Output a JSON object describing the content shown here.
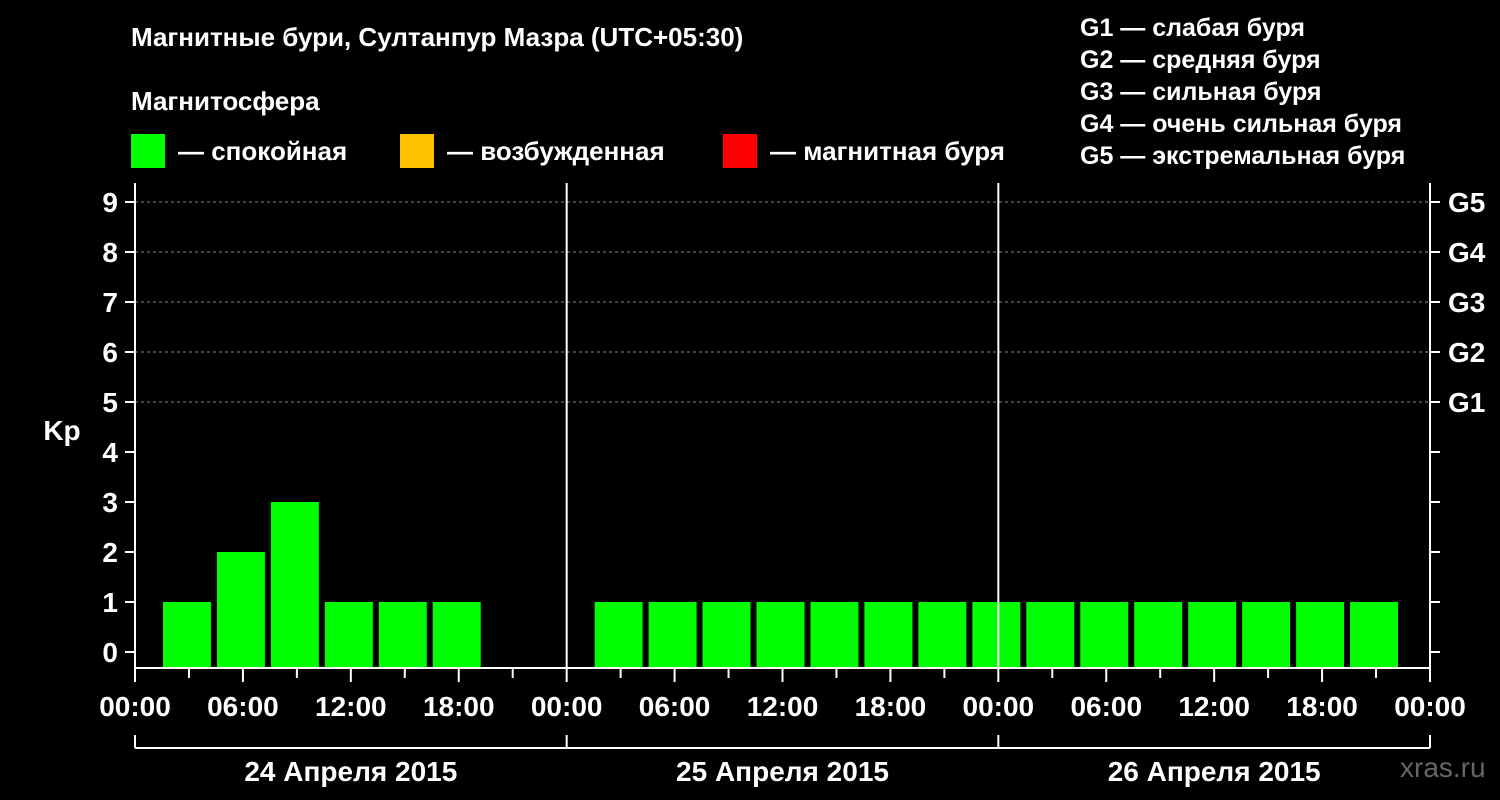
{
  "title": "Магнитные бури, Султанпур Мазра (UTC+05:30)",
  "subtitle": "Магнитосфера",
  "legend": [
    {
      "label": "— спокойная",
      "color": "#00ff00"
    },
    {
      "label": "— возбужденная",
      "color": "#ffc000"
    },
    {
      "label": "— магнитная буря",
      "color": "#ff0000"
    }
  ],
  "g_legend": [
    "G1 — слабая буря",
    "G2 — средняя буря",
    "G3 — сильная буря",
    "G4 — очень сильная буря",
    "G5 — экстремальная буря"
  ],
  "watermark": "xras.ru",
  "chart_data": {
    "type": "bar",
    "ylabel": "Kp",
    "ylim": [
      0,
      9
    ],
    "y_ticks": [
      0,
      1,
      2,
      3,
      4,
      5,
      6,
      7,
      8,
      9
    ],
    "right_ticks": [
      {
        "value": 5,
        "label": "G1"
      },
      {
        "value": 6,
        "label": "G2"
      },
      {
        "value": 7,
        "label": "G3"
      },
      {
        "value": 8,
        "label": "G4"
      },
      {
        "value": 9,
        "label": "G5"
      }
    ],
    "x_tick_labels": [
      "00:00",
      "06:00",
      "12:00",
      "18:00",
      "00:00",
      "06:00",
      "12:00",
      "18:00",
      "00:00",
      "06:00",
      "12:00",
      "18:00",
      "00:00"
    ],
    "days": [
      "24 Апреля 2015",
      "25 Апреля 2015",
      "26 Апреля 2015"
    ],
    "interval_hours": 3,
    "bar_start_hours": [
      1.5,
      4.5,
      7.5,
      10.5,
      13.5,
      16.5,
      25.5,
      28.5,
      31.5,
      34.5,
      37.5,
      40.5,
      43.5,
      46.5,
      49.5,
      52.5,
      55.5,
      58.5,
      61.5,
      64.5,
      67.5
    ],
    "values": [
      1,
      2,
      3,
      1,
      1,
      1,
      1,
      1,
      1,
      1,
      1,
      1,
      1,
      1,
      1,
      1,
      1,
      1,
      1,
      1,
      1
    ],
    "color": "#00ff00",
    "grid": "dashed at 5-9"
  }
}
